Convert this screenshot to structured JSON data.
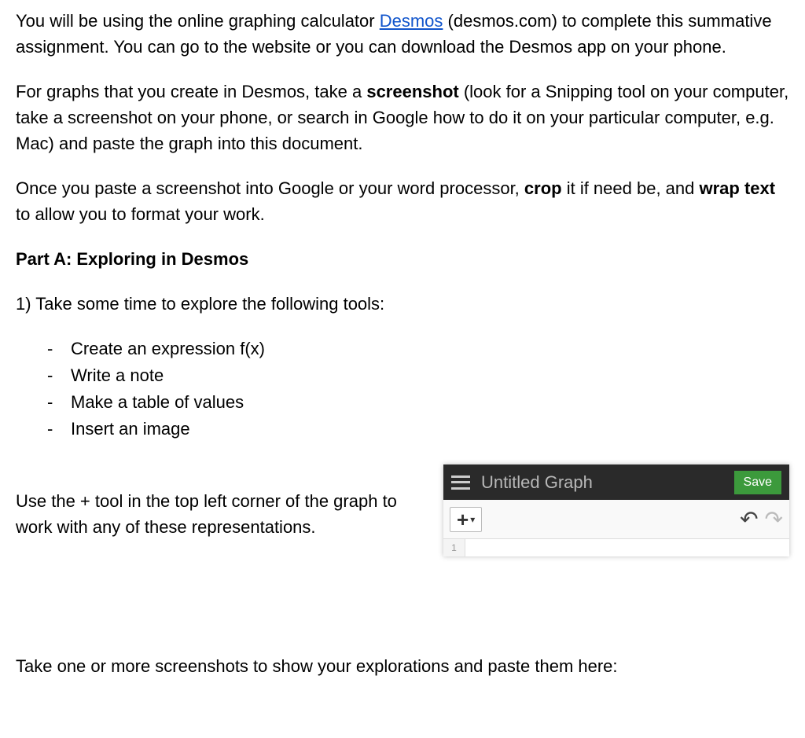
{
  "intro": {
    "p1_prefix": "You will be using the online graphing calculator ",
    "link_text": "Desmos",
    "p1_suffix": " (desmos.com) to complete this summative assignment. You can go to the website or you can download the Desmos app on your phone.",
    "p2_prefix": "For graphs that you create in Desmos, take a ",
    "p2_bold1": "screenshot",
    "p2_suffix": " (look for a Snipping tool on your computer, take a screenshot on your phone, or search in Google how to do it on your particular computer, e.g. Mac) and paste the graph into this document.",
    "p3_a": "Once you paste a screenshot into Google or your word processor, ",
    "p3_bold1": "crop",
    "p3_b": " it if need be, and ",
    "p3_bold2": "wrap text",
    "p3_c": "  to allow you to format your work."
  },
  "partA": {
    "heading": "Part A: Exploring in Desmos",
    "q1": "1) Take some time to explore the following tools:",
    "bullets": [
      "Create an expression f(x)",
      "Write a note",
      "Make a table of values",
      "Insert an image"
    ],
    "below": "Use the + tool in the top left corner of the graph to work with any of these representations.",
    "footer": "Take one or more screenshots to show your explorations and paste them here:"
  },
  "desmos": {
    "title": "Untitled Graph",
    "save": "Save",
    "row_number": "1"
  }
}
